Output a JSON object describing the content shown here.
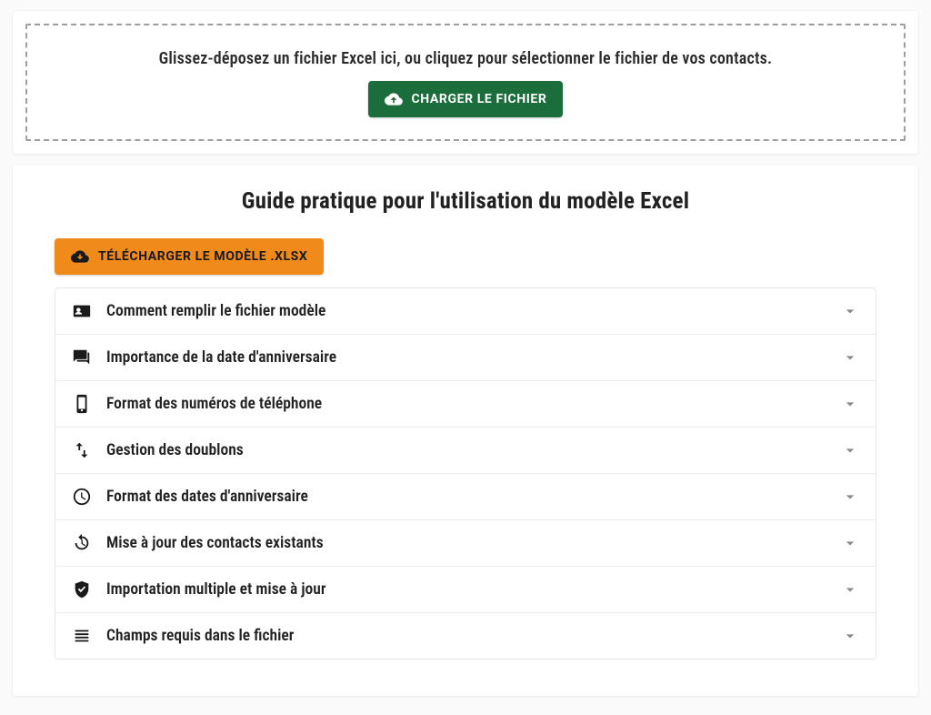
{
  "upload": {
    "instruction": "Glissez-déposez un fichier Excel ici, ou cliquez pour sélectionner le fichier de vos contacts.",
    "button_label": "CHARGER LE FICHIER"
  },
  "guide": {
    "title": "Guide pratique pour l'utilisation du modèle Excel",
    "download_button": "TÉLÉCHARGER LE MODÈLE .XLSX",
    "items": [
      {
        "icon": "contact-card",
        "label": "Comment remplir le fichier modèle"
      },
      {
        "icon": "forum",
        "label": "Importance de la date d'anniversaire"
      },
      {
        "icon": "phone",
        "label": "Format des numéros de téléphone"
      },
      {
        "icon": "swap-vert",
        "label": "Gestion des doublons"
      },
      {
        "icon": "time",
        "label": "Format des dates d'anniversaire"
      },
      {
        "icon": "update",
        "label": "Mise à jour des contacts existants"
      },
      {
        "icon": "shield-check",
        "label": "Importation multiple et mise à jour"
      },
      {
        "icon": "lines",
        "label": "Champs requis dans le fichier"
      }
    ]
  },
  "colors": {
    "primary_green": "#1b6e3b",
    "accent_orange": "#f08a1a"
  }
}
